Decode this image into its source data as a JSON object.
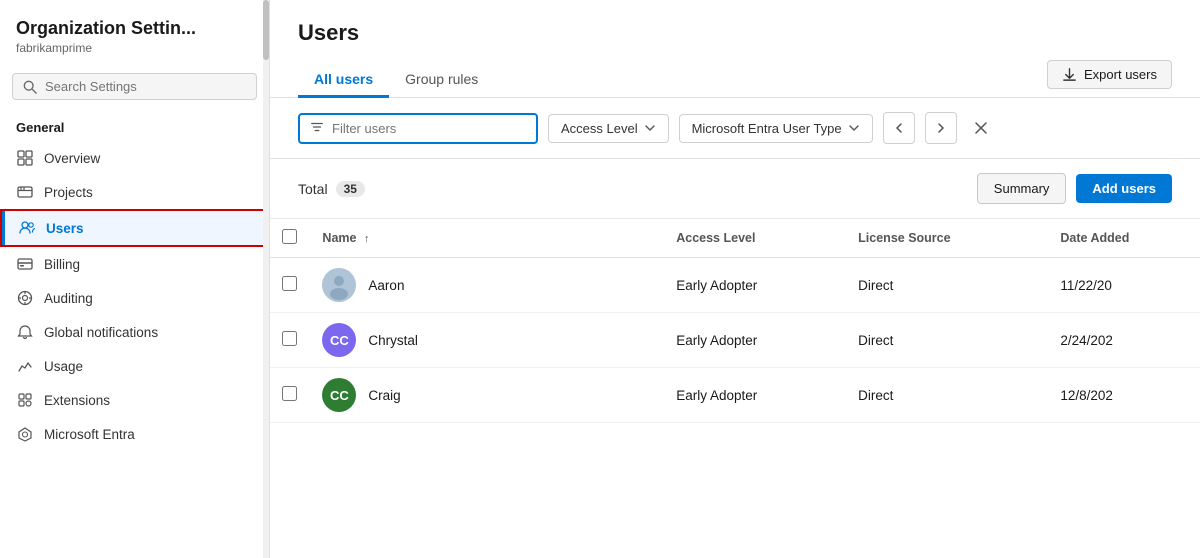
{
  "sidebar": {
    "title": "Organization Settin...",
    "subtitle": "fabrikamprime",
    "search": {
      "placeholder": "Search Settings",
      "value": ""
    },
    "sections": [
      {
        "label": "General",
        "items": [
          {
            "id": "overview",
            "label": "Overview",
            "icon": "grid"
          },
          {
            "id": "projects",
            "label": "Projects",
            "icon": "projects"
          },
          {
            "id": "users",
            "label": "Users",
            "icon": "users",
            "active": true
          },
          {
            "id": "billing",
            "label": "Billing",
            "icon": "billing"
          },
          {
            "id": "auditing",
            "label": "Auditing",
            "icon": "auditing"
          },
          {
            "id": "global-notifications",
            "label": "Global notifications",
            "icon": "bell"
          },
          {
            "id": "usage",
            "label": "Usage",
            "icon": "usage"
          },
          {
            "id": "extensions",
            "label": "Extensions",
            "icon": "extensions"
          },
          {
            "id": "microsoft-entra",
            "label": "Microsoft Entra",
            "icon": "entra"
          }
        ]
      }
    ]
  },
  "main": {
    "page_title": "Users",
    "tabs": [
      {
        "id": "all-users",
        "label": "All users",
        "active": true
      },
      {
        "id": "group-rules",
        "label": "Group rules",
        "active": false
      }
    ],
    "export_button_label": "Export users",
    "filter": {
      "placeholder": "Filter users",
      "value": ""
    },
    "dropdowns": [
      {
        "id": "access-level",
        "label": "Access Level"
      },
      {
        "id": "user-type",
        "label": "Microsoft Entra User Type"
      }
    ],
    "total_label": "Total",
    "total_count": "35",
    "summary_button": "Summary",
    "add_users_button": "Add users",
    "table": {
      "columns": [
        {
          "id": "name",
          "label": "Name",
          "sort": "asc"
        },
        {
          "id": "access-level",
          "label": "Access Level"
        },
        {
          "id": "license-source",
          "label": "License Source"
        },
        {
          "id": "date-added",
          "label": "Date Added"
        }
      ],
      "rows": [
        {
          "id": "aaron",
          "name": "Aaron",
          "avatar_initials": "",
          "avatar_type": "photo",
          "avatar_color": "#b0c4d8",
          "access_level": "Early Adopter",
          "license_source": "Direct",
          "date_added": "11/22/20"
        },
        {
          "id": "chrystal",
          "name": "Chrystal",
          "avatar_initials": "CC",
          "avatar_type": "initials",
          "avatar_color": "#7B68EE",
          "access_level": "Early Adopter",
          "license_source": "Direct",
          "date_added": "2/24/202"
        },
        {
          "id": "craig",
          "name": "Craig",
          "avatar_initials": "CC",
          "avatar_type": "initials",
          "avatar_color": "#2e7d32",
          "access_level": "Early Adopter",
          "license_source": "Direct",
          "date_added": "12/8/202"
        }
      ]
    }
  }
}
